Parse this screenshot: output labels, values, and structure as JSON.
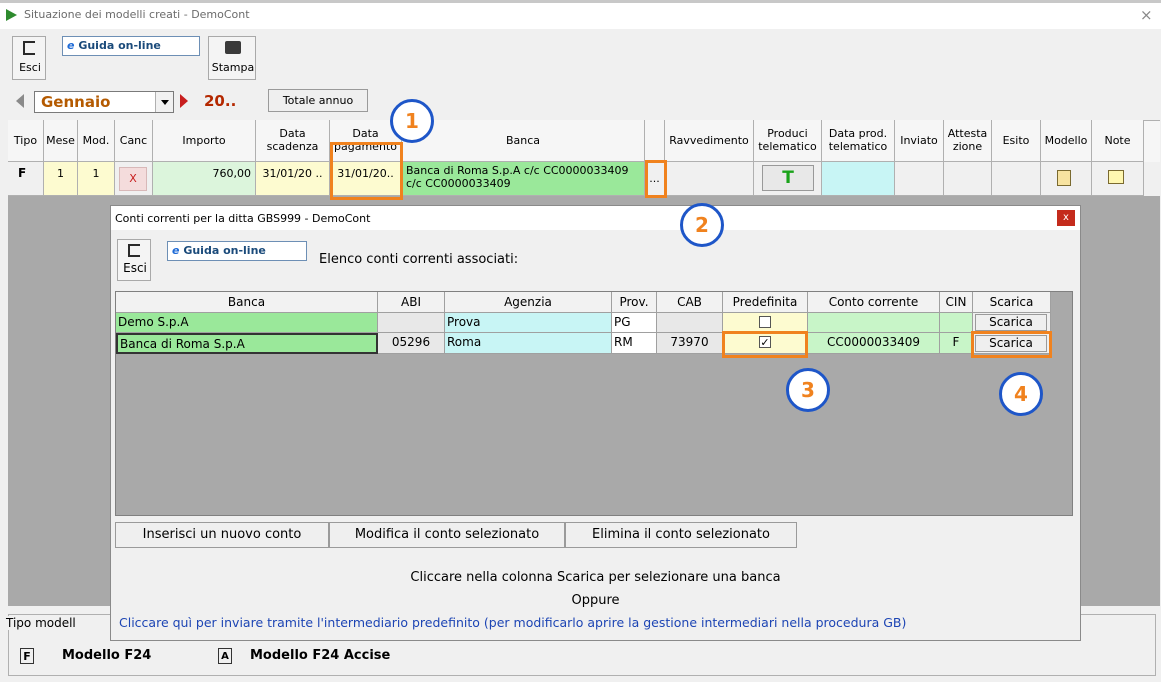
{
  "window": {
    "title": "Situazione dei modelli creati - DemoCont",
    "close_glyph": "×"
  },
  "toolbar": {
    "esci": "Esci",
    "guida": "Guida on-line",
    "stampa": "Stampa"
  },
  "period": {
    "month": "Gennaio",
    "year": "20..",
    "totale_annuo": "Totale annuo"
  },
  "table": {
    "headers": {
      "tipo": "Tipo",
      "mese": "Mese",
      "mod": "Mod.",
      "canc": "Canc",
      "importo": "Importo",
      "data_scadenza": "Data scadenza",
      "data_pagamento": "Data pagamento",
      "banca": "Banca",
      "ravvedimento": "Ravvedimento",
      "produci": "Produci telematico",
      "data_prod": "Data prod. telematico",
      "inviato": "Inviato",
      "attestazione": "Attesta zione",
      "esito": "Esito",
      "modello": "Modello",
      "note": "Note"
    },
    "row": {
      "tipo": "F",
      "mese": "1",
      "mod": "1",
      "canc": "X",
      "importo": "760,00",
      "data_scadenza": "31/01/20 ..",
      "data_pagamento": "31/01/20..",
      "banca_line1": "Banca di Roma S.p.A c/c CC0000033409",
      "banca_line2": "c/c CC0000033409",
      "ellipsis": "...",
      "produci": "T"
    }
  },
  "callouts": {
    "c1": "1",
    "c2": "2",
    "c3": "3",
    "c4": "4"
  },
  "dialog": {
    "title": "Conti correnti per la ditta GBS999 - DemoCont",
    "close": "x",
    "esci": "Esci",
    "guida": "Guida on-line",
    "subtitle": "Elenco conti correnti associati:",
    "headers": {
      "banca": "Banca",
      "abi": "ABI",
      "agenzia": "Agenzia",
      "prov": "Prov.",
      "cab": "CAB",
      "predefinita": "Predefinita",
      "conto": "Conto corrente",
      "cin": "CIN",
      "scarica": "Scarica"
    },
    "rows": [
      {
        "banca": "Demo S.p.A",
        "abi": "",
        "agenzia": "Prova",
        "prov": "PG",
        "cab": "",
        "predefinita": "",
        "conto": "",
        "cin": "",
        "scarica": "Scarica"
      },
      {
        "banca": "Banca di Roma S.p.A",
        "abi": "05296",
        "agenzia": "Roma",
        "prov": "RM",
        "cab": "73970",
        "predefinita": "✓",
        "conto": "CC0000033409",
        "cin": "F",
        "scarica": "Scarica"
      }
    ],
    "buttons": {
      "inserisci": "Inserisci un nuovo conto",
      "modifica": "Modifica il conto selezionato",
      "elimina": "Elimina il conto selezionato"
    },
    "hint1": "Cliccare nella colonna Scarica per selezionare una banca",
    "hint2": "Oppure",
    "link": "Cliccare quì per inviare tramite l'intermediario predefinito (per modificarlo aprire la gestione intermediari nella procedura GB)"
  },
  "legend": {
    "group_label": "Tipo modell",
    "f_icon": "F",
    "f24": "Modello F24",
    "accise_icon": "A",
    "f24_accise": "Modello F24 Accise"
  }
}
